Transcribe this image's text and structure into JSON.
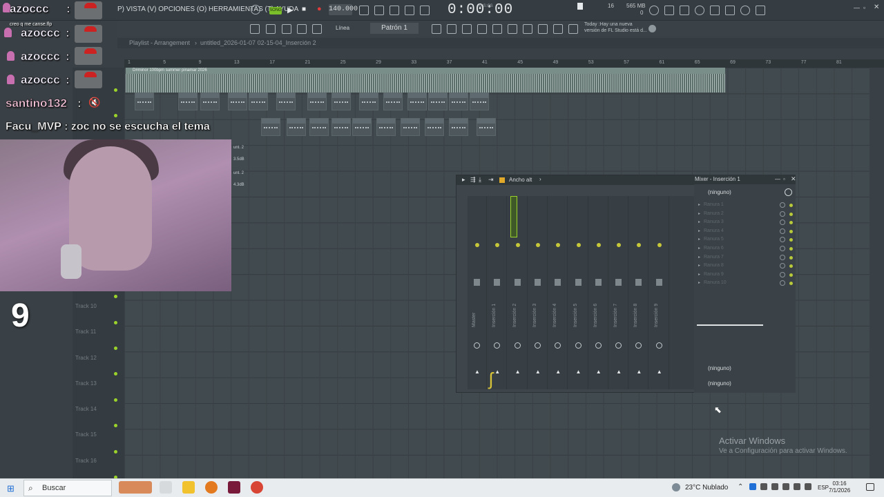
{
  "menu": {
    "items_label": "P) VISTA (V) OPCIONES (O) HERRAMIENTAS (T) AYUDA"
  },
  "transport": {
    "song_badge": "SONG",
    "bpm": "140.000",
    "time": "0:00:00",
    "time_sub": "M:S:CS",
    "cpu": "16",
    "mem": "565 MB",
    "mem_sub": "0"
  },
  "toolbar2": {
    "snap": "Línea",
    "pattern": "Patrón 1",
    "news_line1": "Today :Hay una nueva",
    "news_line2": "versión de FL Studio está d..."
  },
  "playlist": {
    "breadcrumb": "Playlist - Arrangement",
    "separator": "›",
    "project": "untitled_2026-01-07 02-15-04_Inserción 2",
    "ruler": [
      "1",
      "5",
      "9",
      "13",
      "17",
      "21",
      "25",
      "29",
      "33",
      "37",
      "41",
      "45",
      "49",
      "53",
      "57",
      "61",
      "65",
      "69",
      "73",
      "77",
      "81"
    ],
    "audio_clip_title": "D#minor 100bpm summer pinamar 2026",
    "tracks": [
      "Track 10",
      "Track 11",
      "Track 12",
      "Track 13",
      "Track 14",
      "Track 15",
      "Track 16"
    ],
    "clip_labels": [
      "unt. 2",
      "3.5dB",
      "unt. 2",
      "4.3dB"
    ]
  },
  "chat": {
    "users": [
      "azoccc",
      "azoccc",
      "azoccc",
      "azoccc"
    ],
    "colon": ":",
    "small_msg": "creo q me canse.flp",
    "santino": "santino132",
    "facu_user": "Facu_MVP",
    "facu_msg": ": zoc no se escucha el tema",
    "counter": "9"
  },
  "mixer": {
    "title": "Ancho alt",
    "strips": [
      "Master",
      "Inserción 1",
      "Inserción 2",
      "Inserción 3",
      "Inserción 4",
      "Inserción 5",
      "Inserción 6",
      "Inserción 7",
      "Inserción 8",
      "Inserción 9"
    ],
    "panel_title": "Mixer - Inserción 1",
    "preset": "(ninguno)",
    "slots": [
      "Ranura 1",
      "Ranura 2",
      "Ranura 3",
      "Ranura 4",
      "Ranura 5",
      "Ranura 6",
      "Ranura 7",
      "Ranura 8",
      "Ranura 9",
      "Ranura 10"
    ],
    "input": "(ninguno)",
    "output": "(ninguno)"
  },
  "windows": {
    "activate_title": "Activar Windows",
    "activate_sub": "Ve a Configuración para activar Windows."
  },
  "taskbar": {
    "search": "Buscar",
    "weather": "23°C  Nublado",
    "lang": "ESP",
    "time": "03:16",
    "date": "7/1/2026"
  },
  "colors": {
    "accent_green": "#9bd32a",
    "record_red": "#e23b3b",
    "clip_teal": "#5c6e6a"
  }
}
